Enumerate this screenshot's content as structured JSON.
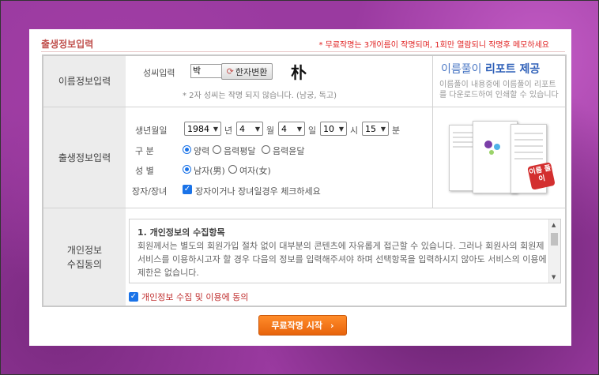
{
  "header": {
    "title": "출생정보입력",
    "notice": "* 무료작명는 3개이름이 작명되며, 1회만 열람되니 작명후 메모하세요"
  },
  "name_section": {
    "label": "이름정보입력",
    "surname_label": "성씨입력",
    "surname_value": "박",
    "hanja_button": "한자변환",
    "hanja_char": "朴",
    "note": "* 2자 성씨는 작명 되지 않습니다. (남궁, 독고)"
  },
  "birth_section": {
    "label": "출생정보입력",
    "date_label": "생년월일",
    "year": "1984",
    "year_unit": "년",
    "month": "4",
    "month_unit": "월",
    "day": "4",
    "day_unit": "일",
    "hour": "10",
    "hour_unit": "시",
    "minute": "15",
    "minute_unit": "분",
    "calendar_label": "구 분",
    "calendar_options": [
      "양력",
      "음력평달",
      "음력윤달"
    ],
    "calendar_selected": "양력",
    "gender_label": "성 별",
    "gender_options": [
      "남자(男)",
      "여자(女)"
    ],
    "gender_selected": "남자(男)",
    "eldest_label": "장자/장녀",
    "eldest_check_label": "장자이거나 장녀일경우 체크하세요",
    "eldest_checked": true
  },
  "promo": {
    "title_part1": "이름풀이",
    "title_part2": "리포트 제공",
    "desc": "이름풀이 내용중에 이름풀이 리포트를 다운로드하여 인쇄할 수 있습니다",
    "badge": "이름 풀이"
  },
  "privacy_section": {
    "label_line1": "개인정보",
    "label_line2": "수집동의",
    "content_title": "1. 개인정보의 수집항목",
    "content_body": "회원께서는 별도의 회원가입 절차 없이 대부분의 콘텐츠에 자유롭게 접근할 수 있습니다. 그러나 회원사의 회원제 서비스를 이용하시고자 할 경우 다음의 정보를 입력해주셔야 하며 선택항목을 입력하시지 않아도 서비스의 이용에 제한은 없습니다.",
    "agree_label": "개인정보 수집 및 이용에 동의",
    "agree_checked": true
  },
  "submit_label": "무료작명 시작"
}
